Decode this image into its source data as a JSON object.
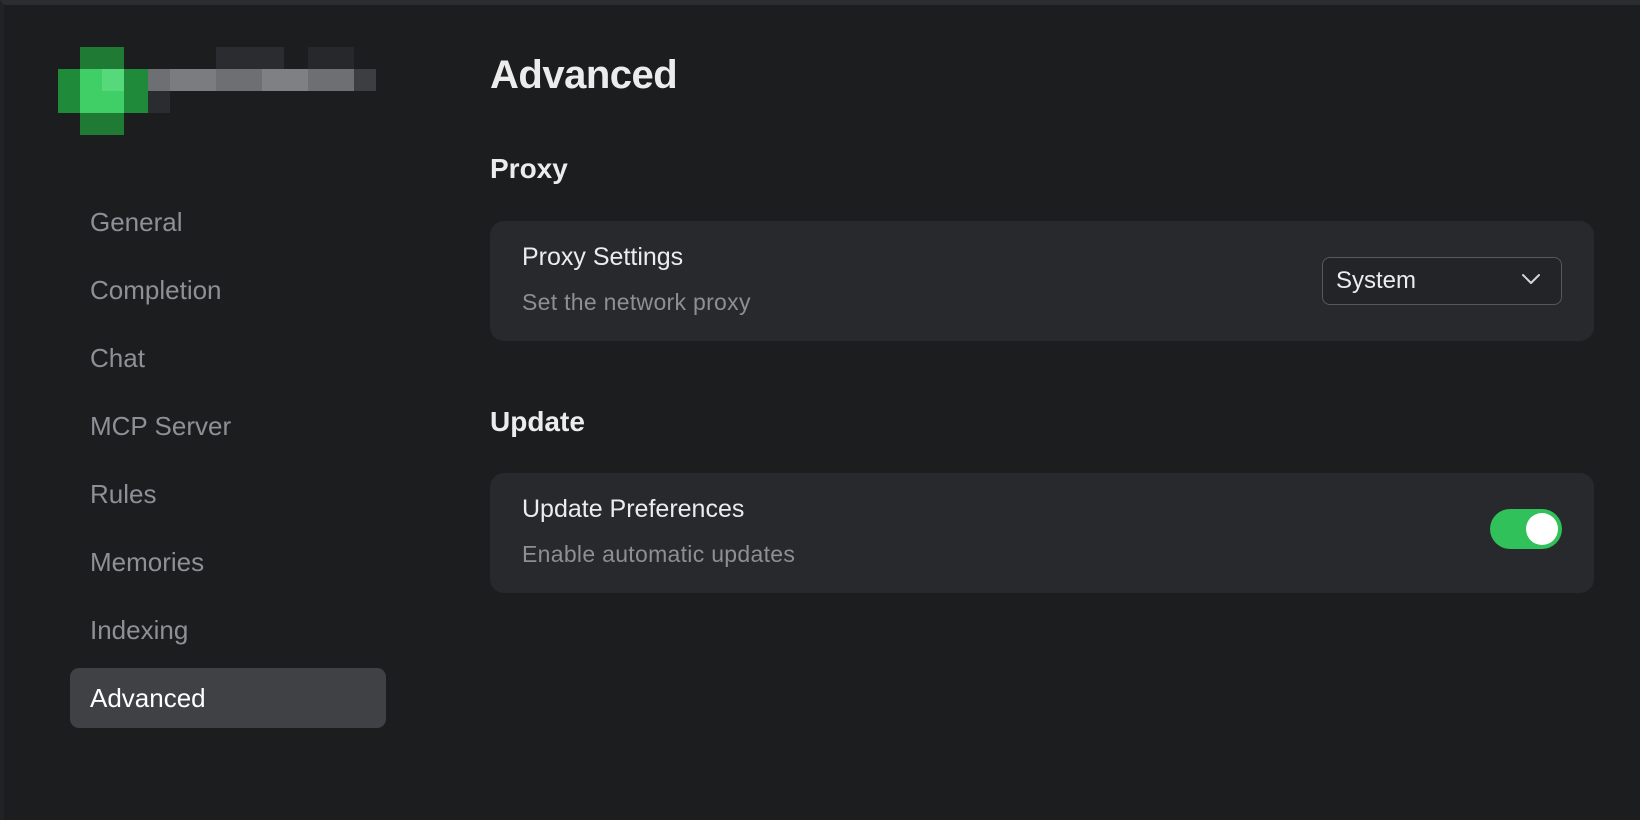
{
  "sidebar": {
    "items": [
      {
        "label": "General"
      },
      {
        "label": "Completion"
      },
      {
        "label": "Chat"
      },
      {
        "label": "MCP Server"
      },
      {
        "label": "Rules"
      },
      {
        "label": "Memories"
      },
      {
        "label": "Indexing"
      },
      {
        "label": "Advanced"
      }
    ],
    "active_index": 7
  },
  "main": {
    "title": "Advanced",
    "proxy": {
      "section_title": "Proxy",
      "setting_title": "Proxy Settings",
      "setting_description": "Set the network proxy",
      "selected_value": "System",
      "icon": "chevron-down-icon"
    },
    "update": {
      "section_title": "Update",
      "setting_title": "Update Preferences",
      "setting_description": "Enable automatic updates",
      "toggle_on": true
    }
  },
  "colors": {
    "background": "#1b1d1f",
    "card": "#28292c",
    "active_nav": "#3f4144",
    "toggle_on": "#30c15a"
  }
}
